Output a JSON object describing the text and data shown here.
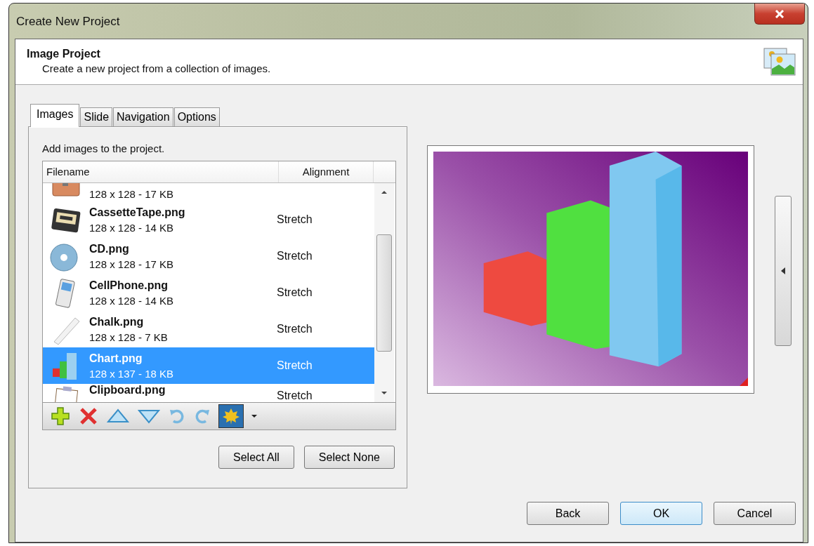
{
  "window": {
    "title": "Create New Project"
  },
  "header": {
    "title": "Image Project",
    "subtitle": "Create a new project from a collection of images."
  },
  "tabs": [
    {
      "label": "Images",
      "selected": true
    },
    {
      "label": "Slide",
      "selected": false
    },
    {
      "label": "Navigation",
      "selected": false
    },
    {
      "label": "Options",
      "selected": false
    }
  ],
  "images_tab": {
    "instruction": "Add images to the project.",
    "columns": [
      "Filename",
      "Alignment"
    ],
    "rows": [
      {
        "kind": "briefcase",
        "details": "128 x 128 - 17 KB",
        "selected": false
      },
      {
        "kind": "cassette",
        "name": "CassetteTape.png",
        "details": "128 x 128 - 14 KB",
        "alignment": "Stretch",
        "selected": false
      },
      {
        "kind": "cd",
        "name": "CD.png",
        "details": "128 x 128 - 17 KB",
        "alignment": "Stretch",
        "selected": false
      },
      {
        "kind": "phone",
        "name": "CellPhone.png",
        "details": "128 x 128 - 14 KB",
        "alignment": "Stretch",
        "selected": false
      },
      {
        "kind": "chalk",
        "name": "Chalk.png",
        "details": "128 x 128 - 7 KB",
        "alignment": "Stretch",
        "selected": false
      },
      {
        "kind": "chart",
        "name": "Chart.png",
        "details": "128 x 137 - 18 KB",
        "alignment": "Stretch",
        "selected": true
      },
      {
        "kind": "clipboard",
        "name": "Clipboard.png",
        "alignment": "Stretch",
        "selected": false
      }
    ],
    "select_buttons": [
      "Select All",
      "Select None"
    ]
  },
  "buttons": [
    "Back",
    "OK",
    "Cancel"
  ]
}
